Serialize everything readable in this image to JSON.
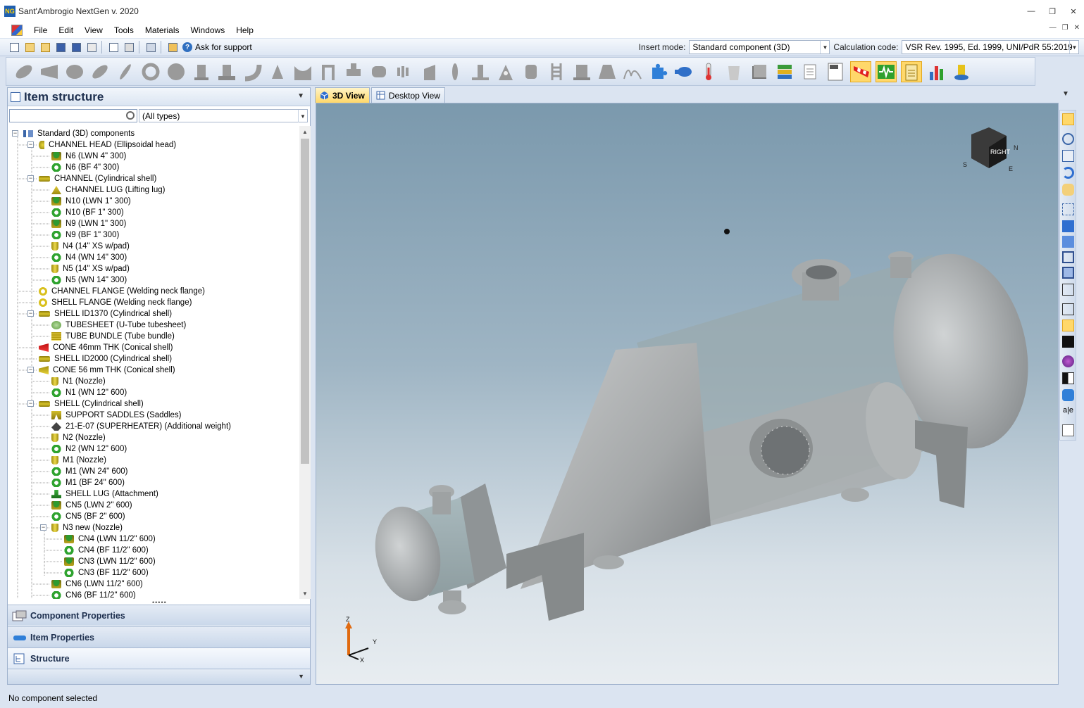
{
  "window": {
    "title": "Sant'Ambrogio NextGen v. 2020",
    "app_icon_text": "NG"
  },
  "menu": [
    "File",
    "Edit",
    "View",
    "Tools",
    "Materials",
    "Windows",
    "Help"
  ],
  "toolbar": {
    "support_label": "Ask for support",
    "insert_mode_label": "Insert mode:",
    "insert_mode_value": "Standard component (3D)",
    "calc_code_label": "Calculation code:",
    "calc_code_value": "VSR Rev. 1995, Ed. 1999, UNI/PdR 55:2019"
  },
  "left_panel": {
    "title": "Item structure",
    "search_placeholder": "",
    "type_filter": "(All types)",
    "tree": [
      {
        "label": "Standard (3D) components",
        "icon": "root",
        "expander": "minus"
      },
      {
        "label": "CHANNEL HEAD (Ellipsoidal head)",
        "icon": "head",
        "expander": "minus"
      },
      {
        "label": "N6 (LWN 4\" 300)",
        "icon": "nozzle-lwn"
      },
      {
        "label": "N6 (BF 4\" 300)",
        "icon": "flange-bf"
      },
      {
        "label": "CHANNEL (Cylindrical shell)",
        "icon": "shell",
        "expander": "minus"
      },
      {
        "label": "CHANNEL LUG (Lifting lug)",
        "icon": "lug"
      },
      {
        "label": "N10 (LWN 1\" 300)",
        "icon": "nozzle-lwn"
      },
      {
        "label": "N10 (BF 1\" 300)",
        "icon": "flange-bf"
      },
      {
        "label": "N9 (LWN 1\" 300)",
        "icon": "nozzle-lwn"
      },
      {
        "label": "N9 (BF 1\" 300)",
        "icon": "flange-bf"
      },
      {
        "label": "N4 (14\" XS w/pad)",
        "icon": "nozzle"
      },
      {
        "label": "N4 (WN 14\" 300)",
        "icon": "flange-wn"
      },
      {
        "label": "N5 (14\" XS w/pad)",
        "icon": "nozzle"
      },
      {
        "label": "N5 (WN 14\" 300)",
        "icon": "flange-wn"
      },
      {
        "label": "CHANNEL FLANGE (Welding neck flange)",
        "icon": "ring"
      },
      {
        "label": "SHELL FLANGE (Welding neck flange)",
        "icon": "ring"
      },
      {
        "label": "SHELL ID1370 (Cylindrical shell)",
        "icon": "shell",
        "expander": "minus"
      },
      {
        "label": "TUBESHEET (U-Tube tubesheet)",
        "icon": "tubesheet"
      },
      {
        "label": "TUBE BUNDLE (Tube bundle)",
        "icon": "bundle"
      },
      {
        "label": "CONE 46mm THK (Conical shell)",
        "icon": "cone-red"
      },
      {
        "label": "SHELL ID2000 (Cylindrical shell)",
        "icon": "shell"
      },
      {
        "label": "CONE 56 mm THK (Conical shell)",
        "icon": "cone",
        "expander": "minus"
      },
      {
        "label": "N1 (Nozzle)",
        "icon": "nozzle"
      },
      {
        "label": "N1 (WN 12\" 600)",
        "icon": "flange-wn"
      },
      {
        "label": "SHELL (Cylindrical shell)",
        "icon": "shell",
        "expander": "minus"
      },
      {
        "label": "SUPPORT SADDLES (Saddles)",
        "icon": "saddle"
      },
      {
        "label": "21-E-07 (SUPERHEATER) (Additional weight)",
        "icon": "weight"
      },
      {
        "label": "N2 (Nozzle)",
        "icon": "nozzle"
      },
      {
        "label": "N2 (WN 12\" 600)",
        "icon": "flange-wn"
      },
      {
        "label": "M1 (Nozzle)",
        "icon": "nozzle"
      },
      {
        "label": "M1 (WN 24\" 600)",
        "icon": "flange-wn"
      },
      {
        "label": "M1 (BF 24\" 600)",
        "icon": "flange-bf"
      },
      {
        "label": "SHELL LUG (Attachment)",
        "icon": "attachment"
      },
      {
        "label": "CN5 (LWN 2\" 600)",
        "icon": "nozzle-lwn"
      },
      {
        "label": "CN5 (BF 2\" 600)",
        "icon": "flange-bf"
      },
      {
        "label": "N3 new (Nozzle)",
        "icon": "nozzle",
        "expander": "minus"
      },
      {
        "label": "CN4 (LWN 11/2\" 600)",
        "icon": "nozzle-lwn"
      },
      {
        "label": "CN4 (BF 11/2\" 600)",
        "icon": "flange-bf"
      },
      {
        "label": "CN3 (LWN 11/2\" 600)",
        "icon": "nozzle-lwn"
      },
      {
        "label": "CN3 (BF 11/2\" 600)",
        "icon": "flange-bf"
      },
      {
        "label": "CN6 (LWN 11/2\" 600)",
        "icon": "nozzle-lwn"
      },
      {
        "label": "CN6 (BF 11/2\" 600)",
        "icon": "flange-bf"
      }
    ]
  },
  "nav_sections": [
    "Component Properties",
    "Item Properties",
    "Structure"
  ],
  "view_tabs": [
    "3D View",
    "Desktop View"
  ],
  "viewcube_face": "RIGHT",
  "compass_labels": [
    "S",
    "E",
    "N"
  ],
  "axis_labels": [
    "Z",
    "Y",
    "X"
  ],
  "status": "No component selected",
  "colors": {
    "accent_active": "#ffd86a",
    "panel_bg": "#dbe4f1",
    "viewport_top": "#7b99ad",
    "viewport_bottom": "#e8edf1"
  }
}
